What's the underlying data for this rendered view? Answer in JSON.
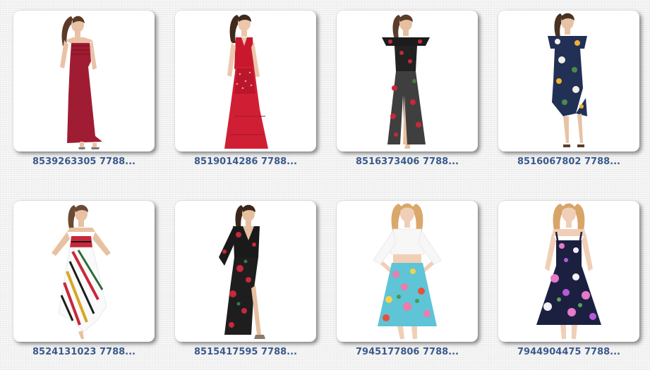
{
  "gallery": {
    "items": [
      {
        "caption": "8539263305 7788...",
        "image": "red-strapless-maxi-dress-photo"
      },
      {
        "caption": "8519014286 7788...",
        "image": "red-sequin-vneck-gown-photo"
      },
      {
        "caption": "8516373406 7788...",
        "image": "black-floral-offshoulder-maxi-photo"
      },
      {
        "caption": "8516067802 7788...",
        "image": "navy-floral-offshoulder-dress-photo"
      },
      {
        "caption": "8524131023 7788...",
        "image": "striped-handkerchief-hem-dress-photo"
      },
      {
        "caption": "8515417595 7788...",
        "image": "black-floral-wrap-maxi-photo"
      },
      {
        "caption": "7945177806 7788...",
        "image": "white-top-floral-skirt-photo"
      },
      {
        "caption": "7944904475 7788...",
        "image": "navy-floral-sundress-photo"
      }
    ]
  },
  "colors": {
    "caption_text": "#3a5a8c",
    "thumbnail_background": "#ffffff",
    "page_background": "#f1f1f1"
  }
}
